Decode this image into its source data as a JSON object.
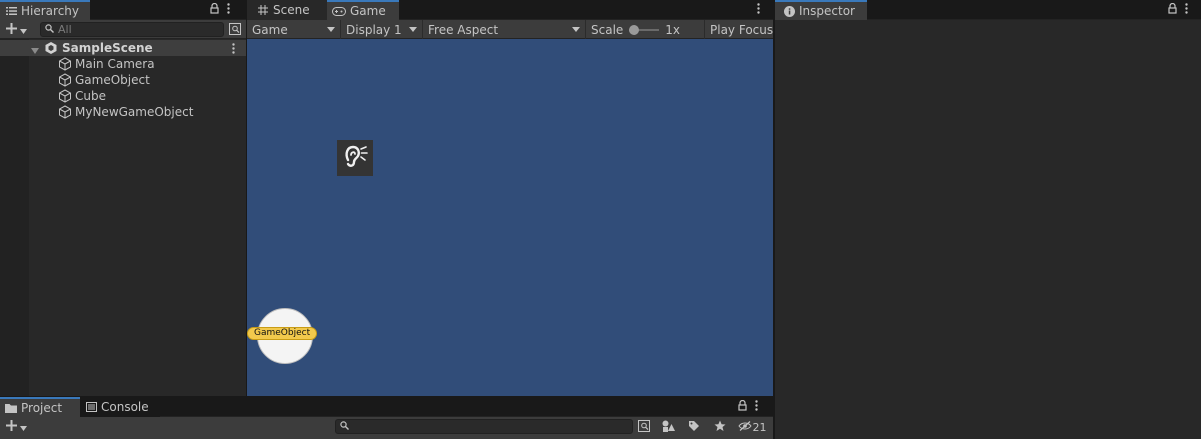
{
  "hierarchy": {
    "tab_label": "Hierarchy",
    "search_placeholder": "All",
    "scene": "SampleScene",
    "items": [
      {
        "label": "Main Camera"
      },
      {
        "label": "GameObject"
      },
      {
        "label": "Cube"
      },
      {
        "label": "MyNewGameObject"
      }
    ]
  },
  "game_panel": {
    "tabs": [
      {
        "label": "Scene",
        "icon": "grid-icon"
      },
      {
        "label": "Game",
        "icon": "gamepad-icon"
      }
    ],
    "toolbar": {
      "view_mode": "Game",
      "display": "Display 1",
      "aspect": "Free Aspect",
      "scale_label": "Scale",
      "scale_value": "1x",
      "scale_level": 0,
      "play_focus": "Play Focus"
    },
    "viewport": {
      "background_color": "#314d79",
      "gizmo_label": "GameObject"
    }
  },
  "inspector": {
    "tab_label": "Inspector"
  },
  "bottom": {
    "tabs": [
      {
        "label": "Project",
        "icon": "folder-icon"
      },
      {
        "label": "Console",
        "icon": "console-icon"
      }
    ],
    "hidden_count": "21"
  },
  "colors": {
    "accent": "#3a79bb",
    "panel": "#282828",
    "toolbar": "#3c3c3c",
    "label_yellow": "#f2c94c"
  }
}
